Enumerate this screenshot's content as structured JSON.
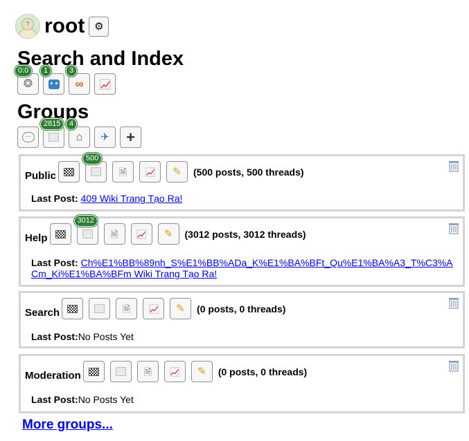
{
  "user": {
    "name": "root",
    "avatar_icon": "user-avatar-icon",
    "settings_icon": "gear-icon"
  },
  "search_index": {
    "title": "Search and Index",
    "buttons": [
      {
        "icon": "spider-web-icon",
        "badge": "0:0"
      },
      {
        "icon": "robot-icon",
        "badge": "1"
      },
      {
        "icon": "pretzel-icon",
        "badge": "3"
      },
      {
        "icon": "chart-icon",
        "badge": ""
      }
    ]
  },
  "groups_section": {
    "title": "Groups",
    "buttons": [
      {
        "icon": "speech-bubble-icon",
        "badge": ""
      },
      {
        "icon": "scroll-icon",
        "badge": "2815"
      },
      {
        "icon": "house-icon",
        "badge": "4"
      },
      {
        "icon": "airplane-icon",
        "badge": ""
      },
      {
        "icon": "plus-icon",
        "badge": ""
      }
    ]
  },
  "groups": [
    {
      "name": "Public",
      "badge": "500",
      "counts": "(500 posts, 500 threads)",
      "last_post_label": "Last Post:",
      "last_post_link": "409 Wiki Trang Tạo Ra!",
      "last_post_text": ""
    },
    {
      "name": "Help",
      "badge": "3012",
      "counts": "(3012 posts, 3012 threads)",
      "last_post_label": "Last Post:",
      "last_post_link": "Ch%E1%BB%89nh_S%E1%BB%ADa_K%E1%BA%BFt_Qu%E1%BA%A3_T%C3%ACm_Ki%E1%BA%BFm Wiki Trang Tạo Ra!",
      "last_post_text": ""
    },
    {
      "name": "Search",
      "badge": "",
      "counts": "(0 posts, 0 threads)",
      "last_post_label": "Last Post:",
      "last_post_link": "",
      "last_post_text": "No Posts Yet"
    },
    {
      "name": "Moderation",
      "badge": "",
      "counts": "(0 posts, 0 threads)",
      "last_post_label": "Last Post:",
      "last_post_link": "",
      "last_post_text": "No Posts Yet"
    }
  ],
  "more_groups": "More groups...",
  "colors": {
    "badge": "#2e7d32",
    "link": "#0000ee",
    "border": "#d4d4d4"
  }
}
